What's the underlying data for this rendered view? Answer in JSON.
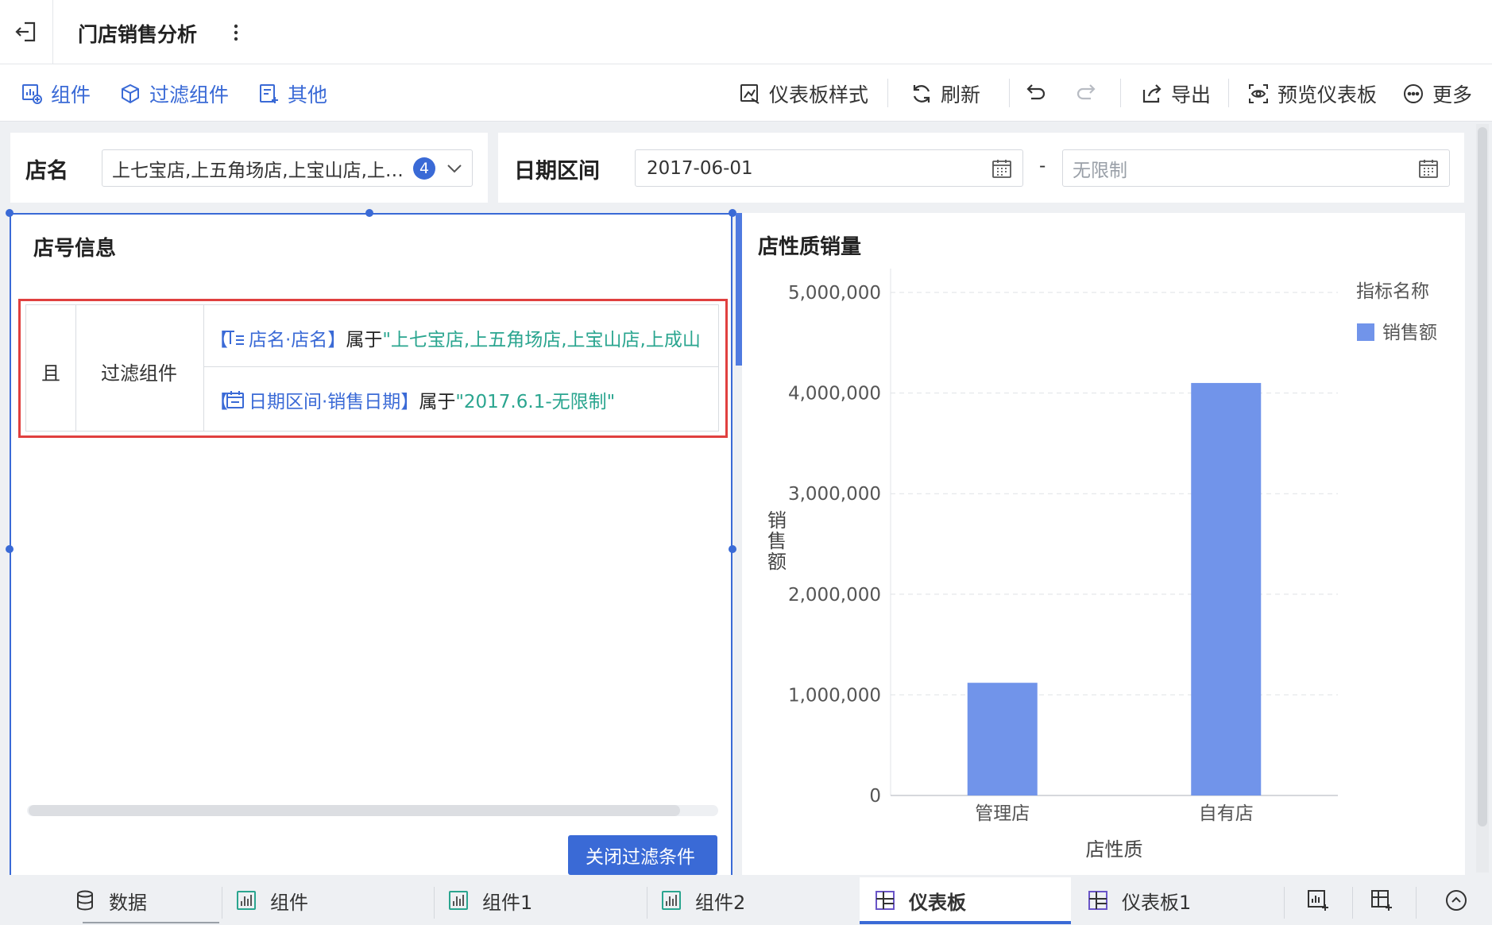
{
  "header": {
    "title": "门店销售分析"
  },
  "toolbar": {
    "left": [
      "组件",
      "过滤组件",
      "其他"
    ],
    "style": "仪表板样式",
    "refresh": "刷新",
    "export": "导出",
    "preview": "预览仪表板",
    "more": "更多"
  },
  "filters": {
    "store": {
      "label": "店名",
      "value": "上七宝店,上五角场店,上宝山店,上…",
      "count": "4"
    },
    "date": {
      "label": "日期区间",
      "start": "2017-06-01",
      "dash": "-",
      "end_placeholder": "无限制"
    }
  },
  "left_widget": {
    "title": "店号信息",
    "logic": "且",
    "group": "过滤组件",
    "cond1": {
      "open": "【",
      "field": "店名·店名",
      "close": "】",
      "op": "属于",
      "value": "\"上七宝店,上五角场店,上宝山店,上成山"
    },
    "cond2": {
      "open": "【",
      "field": "日期区间·销售日期",
      "close": "】",
      "op": "属于",
      "value": "\"2017.6.1-无限制\""
    },
    "close_button": "关闭过滤条件"
  },
  "right_widget": {
    "title": "店性质销量"
  },
  "chart_data": {
    "type": "bar",
    "title": "店性质销量",
    "categories": [
      "管理店",
      "自有店"
    ],
    "series": [
      {
        "name": "销售额",
        "values": [
          1120000,
          4100000
        ],
        "color": "#7194ea"
      }
    ],
    "xlabel": "店性质",
    "ylabel": "销售额",
    "ylim": [
      0,
      5000000
    ],
    "y_ticks": [
      "0",
      "1,000,000",
      "2,000,000",
      "3,000,000",
      "4,000,000",
      "5,000,000"
    ],
    "legend_title": "指标名称",
    "legend_position": "top-right",
    "grid": true
  },
  "tabs": {
    "data": "数据",
    "comp": "组件",
    "comp1": "组件1",
    "comp2": "组件2",
    "dash": "仪表板",
    "dash1": "仪表板1"
  },
  "colors": {
    "accent": "#3a6ad6",
    "bar": "#7194ea",
    "teal": "#2aa58f",
    "highlight_border": "#e0403f"
  }
}
